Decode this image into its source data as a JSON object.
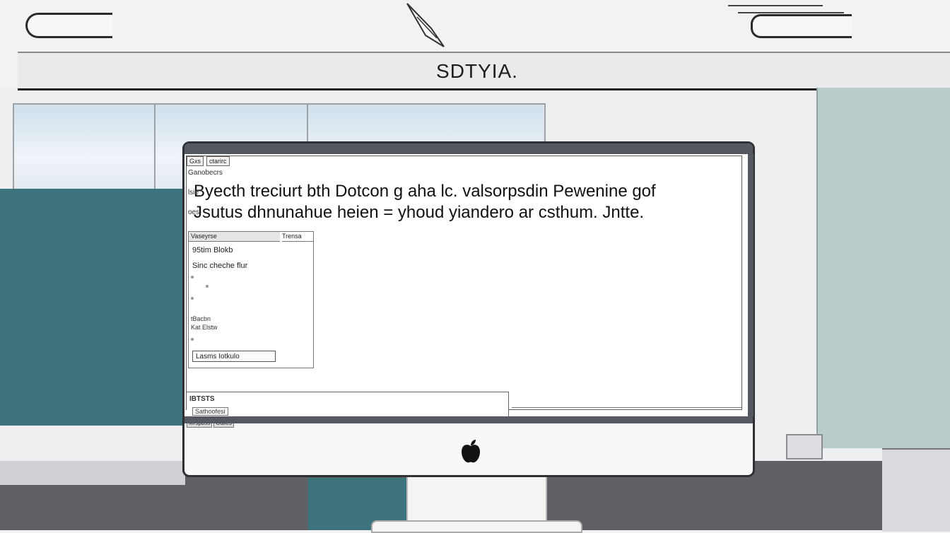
{
  "banner": {
    "title": "SDTYIA."
  },
  "screen": {
    "tabs": [
      "Gxs",
      "ctarirc"
    ],
    "toolbar_label": "Ganobecrs",
    "heading_lines": [
      "Byecth treciurt bth Dotcon g aha lc. valsorpsdin Pewenine gof",
      "Jsutus dhnunahue heien = yhoud yiandero ar csthum. Jntte."
    ],
    "left_margin_labels": [
      "lsie",
      "oes"
    ],
    "side_panel": {
      "title": "Vaseyrse",
      "title_right": "Trensa",
      "rows": [
        "95tim    Blokb",
        "Sinc  cheche flur"
      ],
      "mini_labels": [
        "tBacbn",
        "Kat Elstw"
      ],
      "button_label": "Lasms  Iotkulo"
    },
    "bottom_box": {
      "label": "IBTSTS",
      "sublabel": "Sathoofesi"
    },
    "status_segments": [
      "Mrspbss",
      "Galles"
    ]
  },
  "icons": {
    "logo": "apple-logo-icon"
  },
  "colors": {
    "teal": "#3d737c",
    "bezel": "#545861",
    "sea_glass": "#b7cccb"
  }
}
